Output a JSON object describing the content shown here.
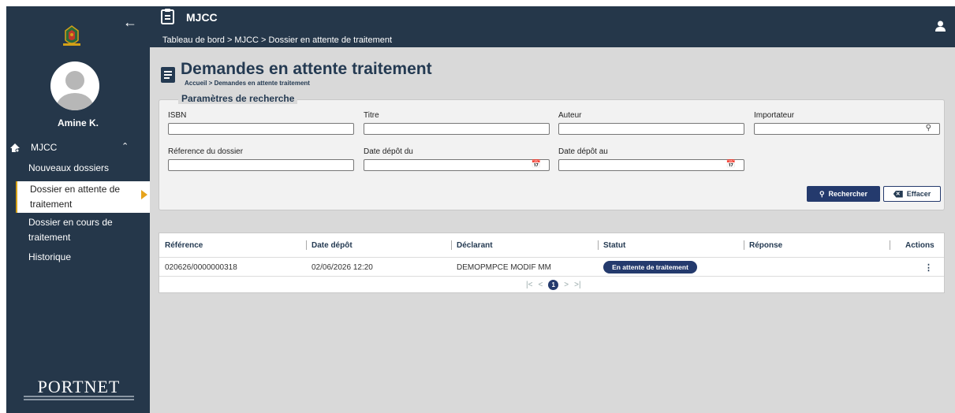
{
  "header": {
    "app_title": "MJCC",
    "breadcrumb": "Tableau de bord > MJCC > Dossier en attente de traitement",
    "back_icon": "arrow-left-icon",
    "user_icon": "person-icon"
  },
  "sidebar": {
    "user_name": "Amine K.",
    "group_label": "MJCC",
    "items": [
      {
        "label": "Nouveaux dossiers"
      },
      {
        "label": "Dossier en attente de traitement"
      },
      {
        "label": "Dossier en cours de traitement"
      },
      {
        "label": "Historique"
      }
    ],
    "active_index": 1,
    "footer_logo": "PORTNET"
  },
  "page": {
    "title": "Demandes en attente traitement",
    "breadcrumb": "Accueil > Demandes en attente traitement"
  },
  "search": {
    "legend": "Paramètres de recherche",
    "fields": {
      "isbn": {
        "label": "ISBN",
        "value": ""
      },
      "titre": {
        "label": "Titre",
        "value": ""
      },
      "auteur": {
        "label": "Auteur",
        "value": ""
      },
      "importateur": {
        "label": "Importateur",
        "value": ""
      },
      "reference": {
        "label": "Réference du dossier",
        "value": ""
      },
      "date_du": {
        "label": "Date dépôt du",
        "value": ""
      },
      "date_au": {
        "label": "Date dépôt au",
        "value": ""
      }
    },
    "search_button": "Rechercher",
    "clear_button": "Effacer"
  },
  "table": {
    "columns": [
      "Référence",
      "Date dépôt",
      "Déclarant",
      "Statut",
      "Réponse",
      "Actions"
    ],
    "rows": [
      {
        "reference": "020626/0000000318",
        "date": "02/06/2026 12:20",
        "declarant": "DEMOPMPCE MODIF MM",
        "statut": "En attente de traitement",
        "reponse": ""
      }
    ],
    "pagination": {
      "current_page": "1",
      "first": "|<",
      "prev": "<",
      "next": ">",
      "last": ">|"
    }
  },
  "colors": {
    "navy": "#25374a",
    "accent": "#243a6d",
    "active_marker": "#e6a31c",
    "background": "#d9d9d9"
  }
}
